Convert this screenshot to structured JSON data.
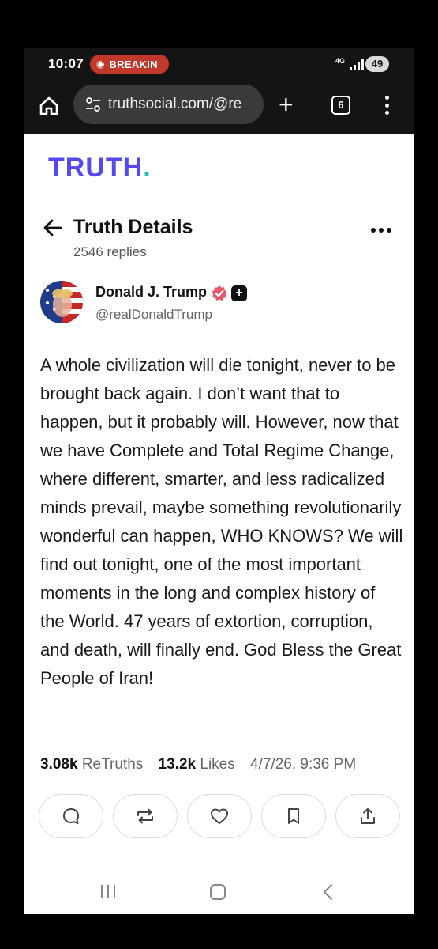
{
  "status_bar": {
    "time": "10:07",
    "breaking_label": "BREAKIN",
    "network": "4G",
    "battery": "49"
  },
  "browser": {
    "url": "truthsocial.com/@re",
    "tab_count": "6"
  },
  "site": {
    "logo_text": "TRUTH",
    "logo_dot": ".",
    "brand_color": "#5448ee",
    "accent_color": "#17c3b2"
  },
  "details": {
    "title": "Truth Details",
    "reply_count": "2546 replies"
  },
  "author": {
    "name": "Donald J. Trump",
    "handle": "@realDonaldTrump"
  },
  "post": {
    "text": "A whole civilization will die tonight, never to be brought back again. I don’t want that to happen, but it probably will. However, now that we have Complete and Total Regime Change, where different, smarter, and less radicalized minds prevail, maybe something revolutionarily wonderful can happen, WHO KNOWS? We will find out tonight, one of the most important moments in the long and complex history of the World. 47 years of extortion, corruption, and death, will finally end. God Bless the Great People of Iran!"
  },
  "stats": {
    "retruths_count": "3.08k",
    "retruths_label": "ReTruths",
    "likes_count": "13.2k",
    "likes_label": "Likes",
    "timestamp": "4/7/26, 9:36 PM"
  },
  "actions": [
    {
      "icon": "reply-icon"
    },
    {
      "icon": "retruth-icon"
    },
    {
      "icon": "heart-icon"
    },
    {
      "icon": "bookmark-icon"
    },
    {
      "icon": "share-icon"
    }
  ]
}
